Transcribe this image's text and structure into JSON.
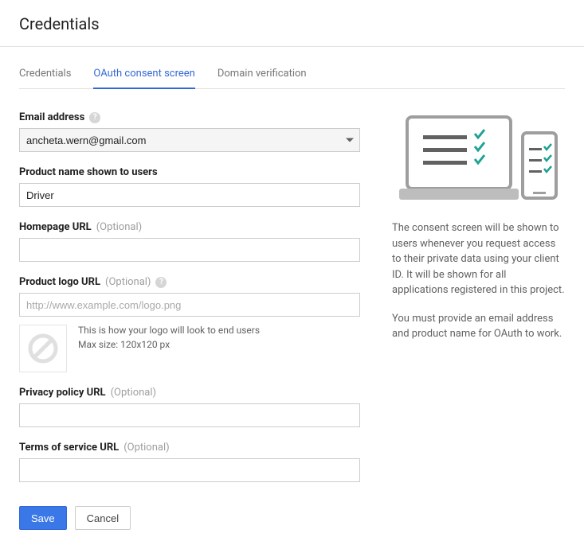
{
  "header": {
    "title": "Credentials"
  },
  "tabs": {
    "credentials": "Credentials",
    "oauth": "OAuth consent screen",
    "domain": "Domain verification",
    "active": "oauth"
  },
  "optional_label": "(Optional)",
  "fields": {
    "email": {
      "label": "Email address",
      "value": "ancheta.wern@gmail.com"
    },
    "product_name": {
      "label": "Product name shown to users",
      "value": "Driver"
    },
    "homepage_url": {
      "label": "Homepage URL",
      "value": ""
    },
    "logo_url": {
      "label": "Product logo URL",
      "placeholder": "http://www.example.com/logo.png",
      "value": "",
      "preview_line1": "This is how your logo will look to end users",
      "preview_line2": "Max size: 120x120 px"
    },
    "privacy_url": {
      "label": "Privacy policy URL",
      "value": ""
    },
    "tos_url": {
      "label": "Terms of service URL",
      "value": ""
    }
  },
  "buttons": {
    "save": "Save",
    "cancel": "Cancel"
  },
  "side": {
    "p1": "The consent screen will be shown to users whenever you request access to their private data using your client ID. It will be shown for all applications registered in this project.",
    "p2": "You must provide an email address and product name for OAuth to work."
  }
}
